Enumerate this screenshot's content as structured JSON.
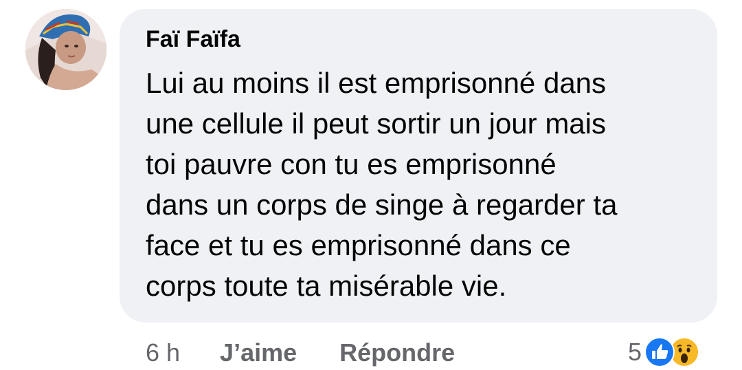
{
  "comment": {
    "author": "Faï Faïfa",
    "text_lines": [
      "Lui au moins il est emprisonné dans",
      "une cellule il peut sortir un jour mais",
      "toi pauvre con tu es emprisonné",
      "dans un corps de singe à regarder ta",
      "face et tu es emprisonné dans ce",
      "corps toute ta misérable vie."
    ]
  },
  "actions": {
    "timestamp": "6 h",
    "like_label": "J’aime",
    "reply_label": "Répondre"
  },
  "reactions": {
    "count": "5",
    "icons": [
      "like-icon",
      "wow-icon"
    ],
    "like_color": "#1877f2",
    "wow_color": "#f7b928"
  },
  "colors": {
    "bubble": "#eff1f5",
    "secondary_text": "#65676b",
    "primary_text": "#050505"
  }
}
